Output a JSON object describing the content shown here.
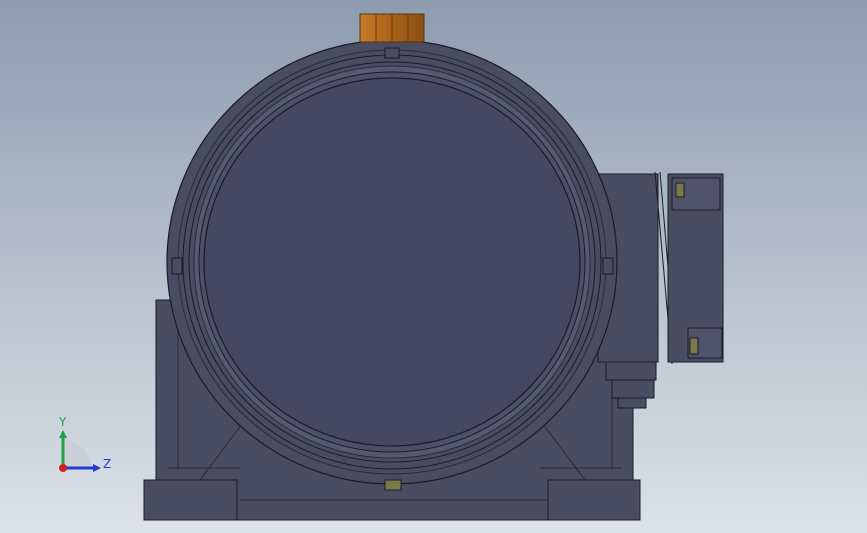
{
  "view": {
    "orientation": "front",
    "background_top": "#8e9cb0",
    "background_bottom": "#dde1e8",
    "body_color": "#4a4d62",
    "outline_color": "#1a1b24",
    "cap_color": "#b06a20",
    "bolt_color": "#7a7a48"
  },
  "triad": {
    "y_label": "Y",
    "z_label": "Z",
    "y_color": "#1fa24a",
    "z_color": "#1f3bd1",
    "x_color": "#d21f1f"
  }
}
